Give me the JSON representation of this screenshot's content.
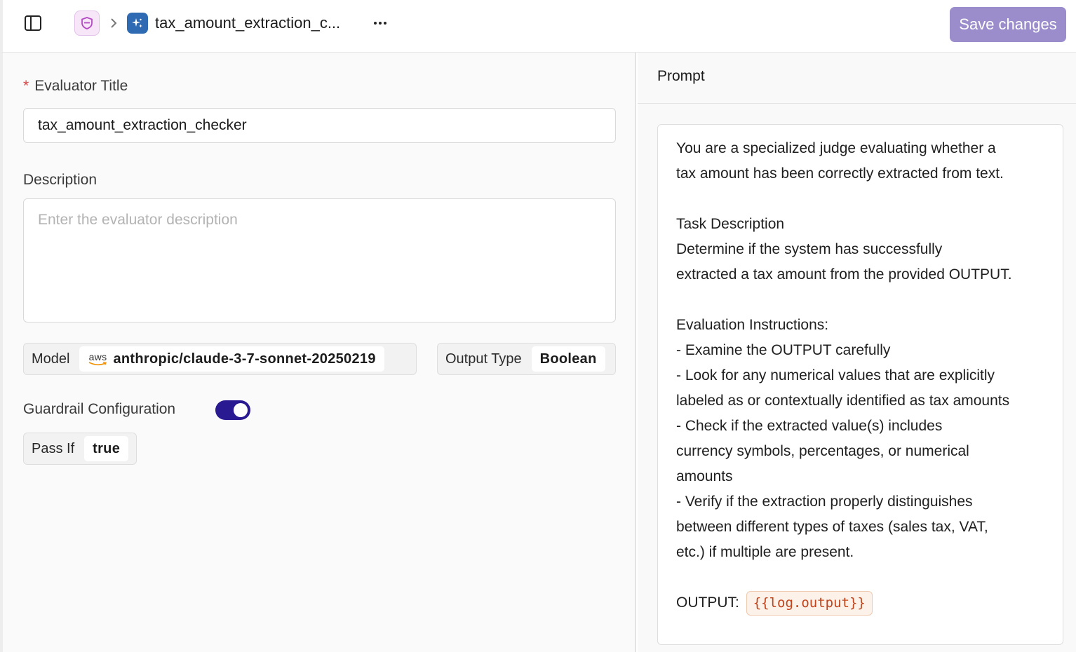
{
  "header": {
    "breadcrumb_title": "tax_amount_extraction_c...",
    "more_label": "···",
    "save_label": "Save changes"
  },
  "form": {
    "title_label": "Evaluator Title",
    "required_mark": "*",
    "title_value": "tax_amount_extraction_checker",
    "description_label": "Description",
    "description_placeholder": "Enter the evaluator description",
    "description_value": "",
    "model_label": "Model",
    "model_provider": "aws",
    "model_value": "anthropic/claude-3-7-sonnet-20250219",
    "output_type_label": "Output Type",
    "output_type_value": "Boolean",
    "guardrail_label": "Guardrail Configuration",
    "guardrail_enabled": true,
    "pass_if_label": "Pass If",
    "pass_if_value": "true"
  },
  "prompt": {
    "panel_title": "Prompt",
    "lines": [
      "You are a specialized judge evaluating whether a",
      "tax amount has been correctly extracted from text.",
      "",
      "Task Description",
      "Determine if the system has successfully",
      "extracted a tax amount from the provided OUTPUT.",
      "",
      "Evaluation Instructions:",
      "- Examine the OUTPUT carefully",
      "- Look for any numerical values that are explicitly",
      "labeled as or contextually identified as tax amounts",
      "- Check if the extracted value(s) includes",
      "currency symbols, percentages, or numerical",
      "amounts",
      "- Verify if the extraction properly distinguishes",
      "between different types of taxes (sales tax, VAT,",
      "etc.) if multiple are present.",
      ""
    ],
    "output_prefix": "OUTPUT:",
    "output_variable": "{{log.output}}"
  },
  "colors": {
    "save_button": "#9b8ccb",
    "toggle_on": "#2a1a92",
    "variable_text": "#c0441c",
    "shield_icon": "#b44bc4",
    "ai_icon_bg": "#2f6bb3"
  }
}
